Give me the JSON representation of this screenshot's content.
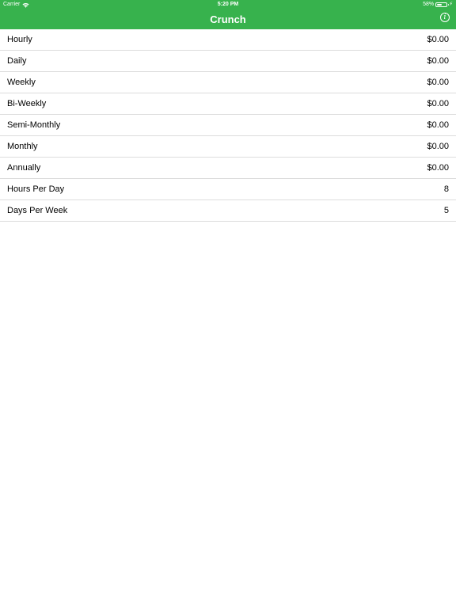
{
  "status_bar": {
    "carrier": "Carrier",
    "time": "5:20 PM",
    "battery": "58%",
    "battery_level": 0.58
  },
  "nav": {
    "title": "Crunch",
    "info_label": "i"
  },
  "colors": {
    "accent": "#37b24d",
    "separator": "#dcdcdc"
  },
  "rows": [
    {
      "label": "Hourly",
      "value": "$0.00"
    },
    {
      "label": "Daily",
      "value": "$0.00"
    },
    {
      "label": "Weekly",
      "value": "$0.00"
    },
    {
      "label": "Bi-Weekly",
      "value": "$0.00"
    },
    {
      "label": "Semi-Monthly",
      "value": "$0.00"
    },
    {
      "label": "Monthly",
      "value": "$0.00"
    },
    {
      "label": "Annually",
      "value": "$0.00"
    },
    {
      "label": "Hours Per Day",
      "value": "8"
    },
    {
      "label": "Days Per Week",
      "value": "5"
    }
  ]
}
